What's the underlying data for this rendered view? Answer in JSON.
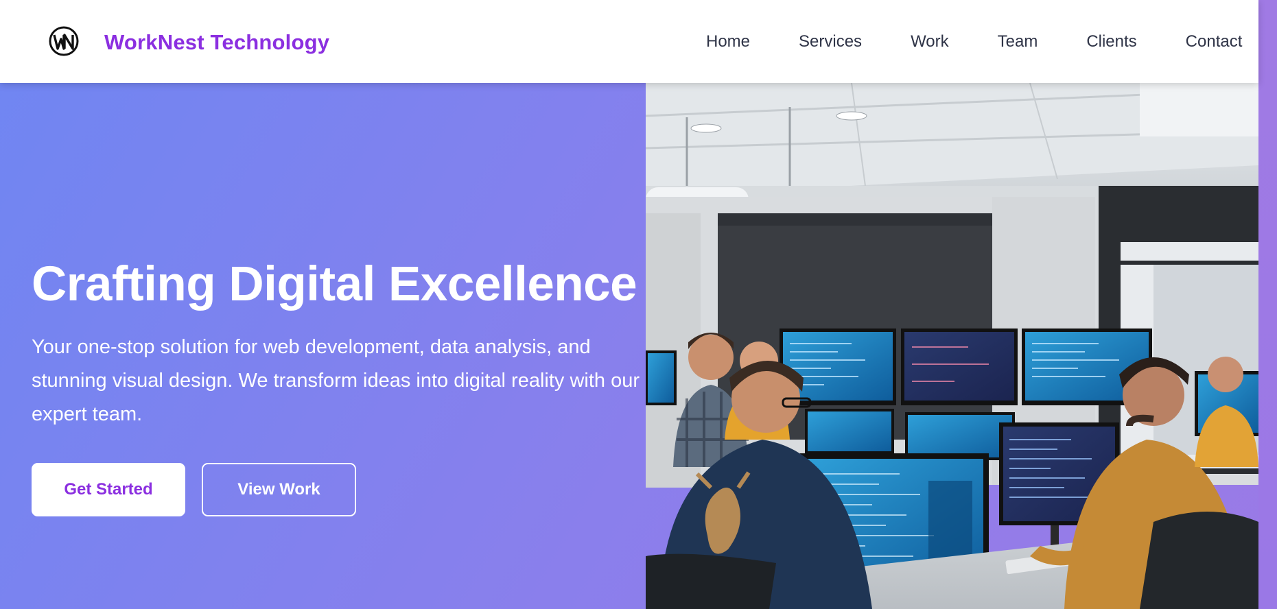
{
  "header": {
    "brand": "WorkNest Technology",
    "logo_icon": "wn-monogram-icon",
    "nav": [
      {
        "label": "Home"
      },
      {
        "label": "Services"
      },
      {
        "label": "Work"
      },
      {
        "label": "Team"
      },
      {
        "label": "Clients"
      },
      {
        "label": "Contact"
      }
    ]
  },
  "hero": {
    "title": "Crafting Digital Excellence",
    "subtitle": "Your one-stop solution for web development, data analysis, and stunning visual design. We transform ideas into digital reality with our expert team.",
    "primary_button": "Get Started",
    "secondary_button": "View Work",
    "image": "office-developers-photo"
  },
  "colors": {
    "brand": "#8b2fe0",
    "gradient_start": "#6f86f2",
    "gradient_end": "#9b7ae6",
    "nav_text": "#2f3447"
  }
}
